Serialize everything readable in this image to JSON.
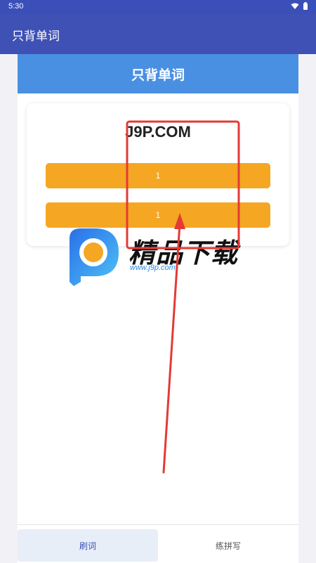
{
  "status_bar": {
    "time": "5:30",
    "icons": [
      "wifi-icon",
      "battery-icon"
    ]
  },
  "app_bar": {
    "title": "只背单词"
  },
  "header": {
    "title": "只背单词"
  },
  "word_card": {
    "word": "J9P.COM",
    "options": [
      "1",
      "1"
    ]
  },
  "watermark": {
    "name": "精品下载",
    "url": "www.j9p.com"
  },
  "bottom_nav": {
    "items": [
      {
        "label": "刷词",
        "active": true
      },
      {
        "label": "练拼写",
        "active": false
      }
    ]
  },
  "colors": {
    "app_bar": "#3f51b5",
    "header_band": "#4a90e2",
    "option_button": "#f5a623",
    "annotation": "#e53935"
  }
}
